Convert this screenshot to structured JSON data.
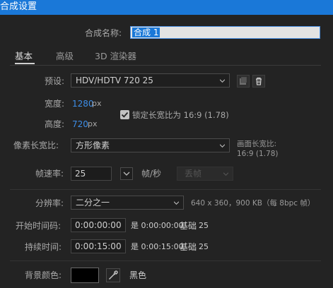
{
  "window": {
    "title": "合成设置"
  },
  "comp_name": {
    "label": "合成名称:",
    "value": "合成 1"
  },
  "tabs": [
    {
      "label": "基本",
      "active": true
    },
    {
      "label": "高级",
      "active": false
    },
    {
      "label": "3D 渲染器",
      "active": false
    }
  ],
  "preset": {
    "label": "预设:",
    "value": "HDV/HDTV 720 25",
    "icons": [
      "save-preset-icon",
      "trash-icon"
    ]
  },
  "width": {
    "label": "宽度:",
    "value": "1280",
    "unit": "px"
  },
  "height": {
    "label": "高度:",
    "value": "720",
    "unit": "px"
  },
  "lock_aspect": {
    "label": "锁定长宽比为 16:9 (1.78)",
    "checked": true
  },
  "pixel_aspect": {
    "label": "像素长宽比:",
    "value": "方形像素"
  },
  "frame_aspect": {
    "label": "画面长宽比:",
    "value": "16:9 (1.78)"
  },
  "frame_rate": {
    "label": "帧速率:",
    "value": "25",
    "unit": "帧/秒",
    "drop_frame": "丢帧"
  },
  "resolution": {
    "label": "分辨率:",
    "value": "二分之一",
    "info": "640 x 360，900 KB（每 8bpc 帧）"
  },
  "start_timecode": {
    "label": "开始时间码:",
    "value": "0:00:00:00",
    "info": "是 0:00:00:00",
    "base_label": "基础",
    "base_value": "25"
  },
  "duration": {
    "label": "持续时间:",
    "value": "0:00:15:00",
    "info": "是 0:00:15:00",
    "base_label": "基础",
    "base_value": "25"
  },
  "background": {
    "label": "背景颜色:",
    "color": "#000000",
    "color_name": "黑色"
  },
  "colors": {
    "accent": "#1a78d8",
    "link_value": "#3d8ee8",
    "panel": "#232323"
  }
}
